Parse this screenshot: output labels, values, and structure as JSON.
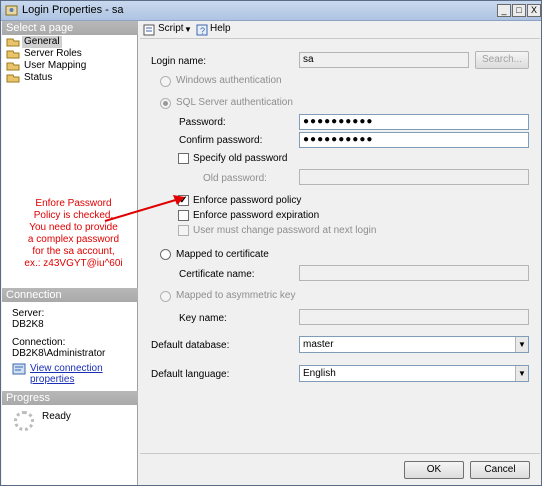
{
  "window": {
    "title": "Login Properties - sa",
    "minimize": "_",
    "maximize": "□",
    "close": "X"
  },
  "left": {
    "select_page_header": "Select a page",
    "pages": [
      "General",
      "Server Roles",
      "User Mapping",
      "Status"
    ],
    "connection_header": "Connection",
    "server_label": "Server:",
    "server_value": "DB2K8",
    "connection_label": "Connection:",
    "connection_value": "DB2K8\\Administrator",
    "view_connection_link": "View connection properties",
    "progress_header": "Progress",
    "progress_status": "Ready"
  },
  "toolbar": {
    "script_label": "Script",
    "help_label": "Help"
  },
  "form": {
    "login_name_label": "Login name:",
    "login_name_value": "sa",
    "search_button": "Search...",
    "windows_auth_label": "Windows authentication",
    "sql_auth_label": "SQL Server authentication",
    "password_label": "Password:",
    "password_value": "●●●●●●●●●●",
    "confirm_password_label": "Confirm password:",
    "confirm_password_value": "●●●●●●●●●●",
    "specify_old_password_label": "Specify old password",
    "old_password_label": "Old password:",
    "enforce_policy_label": "Enforce password policy",
    "enforce_expiration_label": "Enforce password expiration",
    "must_change_label": "User must change password at next login",
    "mapped_cert_label": "Mapped to certificate",
    "cert_name_label": "Certificate name:",
    "mapped_asym_label": "Mapped to asymmetric key",
    "key_name_label": "Key name:",
    "default_db_label": "Default database:",
    "default_db_value": "master",
    "default_lang_label": "Default language:",
    "default_lang_value": "English",
    "enforce_policy_checked": true
  },
  "annotation": {
    "lines": [
      "Enfore Password",
      "Policy is checked.",
      "You need to provide",
      "a complex password",
      "for the sa account,",
      "ex.: z43VGYT@iu^60i"
    ],
    "color": "#e00000"
  },
  "buttons": {
    "ok": "OK",
    "cancel": "Cancel"
  }
}
